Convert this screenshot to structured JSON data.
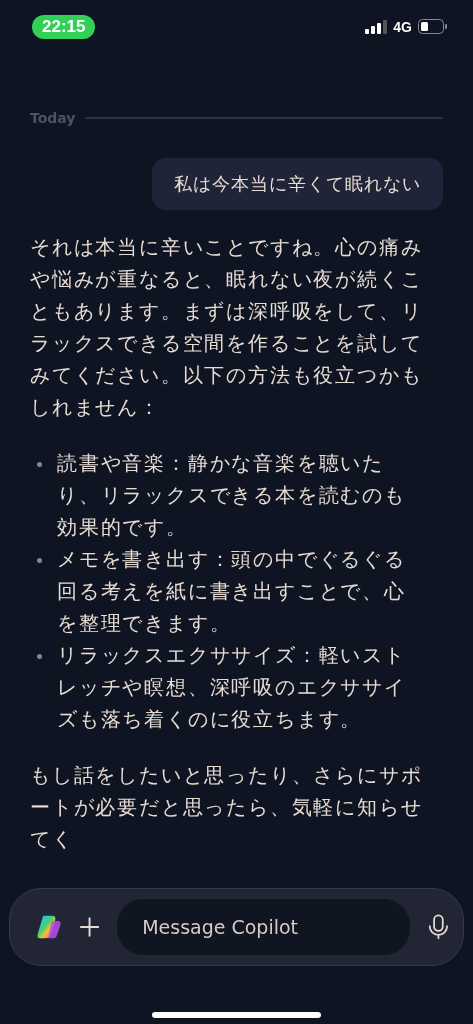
{
  "status_bar": {
    "time": "22:15",
    "network": "4G"
  },
  "divider": {
    "label": "Today"
  },
  "messages": [
    {
      "kind": "user",
      "text": "私は今本当に辛くて眠れない"
    },
    {
      "kind": "assistant",
      "intro": "それは本当に辛いことですね。心の痛みや悩みが重なると、眠れない夜が続くこともあります。まずは深呼吸をして、リラックスできる空間を作ることを試してみてください。以下の方法も役立つかもしれません：",
      "bullets": [
        "読書や音楽：静かな音楽を聴いたり、リラックスできる本を読むのも効果的です。",
        "メモを書き出す：頭の中でぐるぐる回る考えを紙に書き出すことで、心を整理できます。",
        "リラックスエクササイズ：軽いストレッチや瞑想、深呼吸のエクササイズも落ち着くのに役立ちます。"
      ],
      "outro": "もし話をしたいと思ったり、さらにサポートが必要だと思ったら、気軽に知らせてく"
    }
  ],
  "composer": {
    "placeholder": "Message Copilot"
  }
}
